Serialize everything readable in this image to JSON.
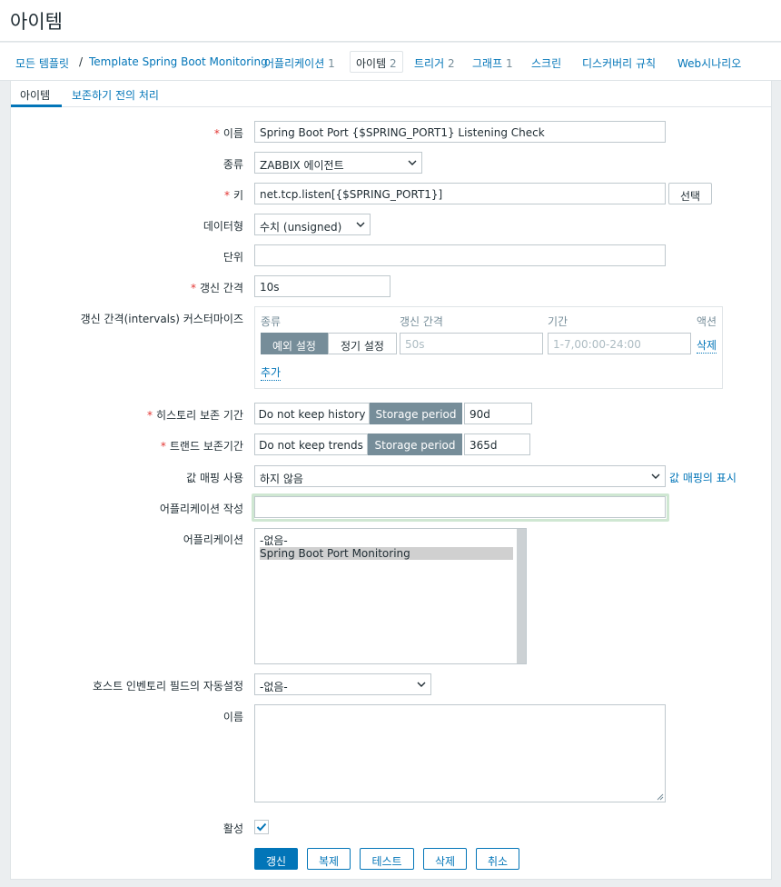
{
  "page_title": "아이템",
  "breadcrumb": {
    "all_templates": "모든 템플릿",
    "separator": "/",
    "template_name": "Template Spring Boot Monitoring"
  },
  "nav_tabs": [
    {
      "label": "어플리케이션",
      "count": "1"
    },
    {
      "label": "아이템",
      "count": "2"
    },
    {
      "label": "트리거",
      "count": "2"
    },
    {
      "label": "그래프",
      "count": "1"
    },
    {
      "label": "스크린",
      "count": ""
    },
    {
      "label": "디스커버리 규칙",
      "count": ""
    },
    {
      "label": "Web시나리오",
      "count": ""
    }
  ],
  "sub_tabs": {
    "item": "아이템",
    "preprocessing": "보존하기 전의 처리"
  },
  "form": {
    "name": {
      "label": "이름",
      "value": "Spring Boot Port {$SPRING_PORT1} Listening Check"
    },
    "type": {
      "label": "종류",
      "value": "ZABBIX 에이전트"
    },
    "key": {
      "label": "키",
      "value": "net.tcp.listen[{$SPRING_PORT1}]",
      "select_button": "선택"
    },
    "data_type": {
      "label": "데이터형",
      "value": "수치 (unsigned)"
    },
    "units": {
      "label": "단위",
      "value": ""
    },
    "update_interval": {
      "label": "갱신 간격",
      "value": "10s"
    },
    "custom_intervals": {
      "label": "갱신 간격(intervals) 커스터마이즈",
      "col_type": "종류",
      "col_interval": "갱신 간격",
      "col_period": "기간",
      "col_action": "액션",
      "flexible": "예외 설정",
      "scheduling": "정기 설정",
      "interval_placeholder": "50s",
      "period_placeholder": "1-7,00:00-24:00",
      "remove": "삭제",
      "add": "추가"
    },
    "history": {
      "label": "히스토리 보존 기간",
      "opt_off": "Do not keep history",
      "opt_on": "Storage period",
      "value": "90d"
    },
    "trends": {
      "label": "트랜드 보존기간",
      "opt_off": "Do not keep trends",
      "opt_on": "Storage period",
      "value": "365d"
    },
    "value_mapping": {
      "label": "값 매핑 사용",
      "value": "하지 않음",
      "link": "값 매핑의 표시"
    },
    "new_application": {
      "label": "어플리케이션 작성",
      "value": ""
    },
    "applications": {
      "label": "어플리케이션",
      "options": [
        "-없음-",
        "Spring Boot Port Monitoring"
      ]
    },
    "inventory_field": {
      "label": "호스트 인벤토리 필드의 자동설정",
      "value": "-없음-"
    },
    "description": {
      "label": "이름",
      "value": ""
    },
    "enabled": {
      "label": "활성",
      "checked": true
    }
  },
  "buttons": {
    "update": "갱신",
    "clone": "복제",
    "test": "테스트",
    "delete": "삭제",
    "cancel": "취소"
  },
  "colors": {
    "primary": "#0275b8",
    "segment_active": "#768d99",
    "required": "#e33734",
    "focus_border": "#b3dab8"
  }
}
